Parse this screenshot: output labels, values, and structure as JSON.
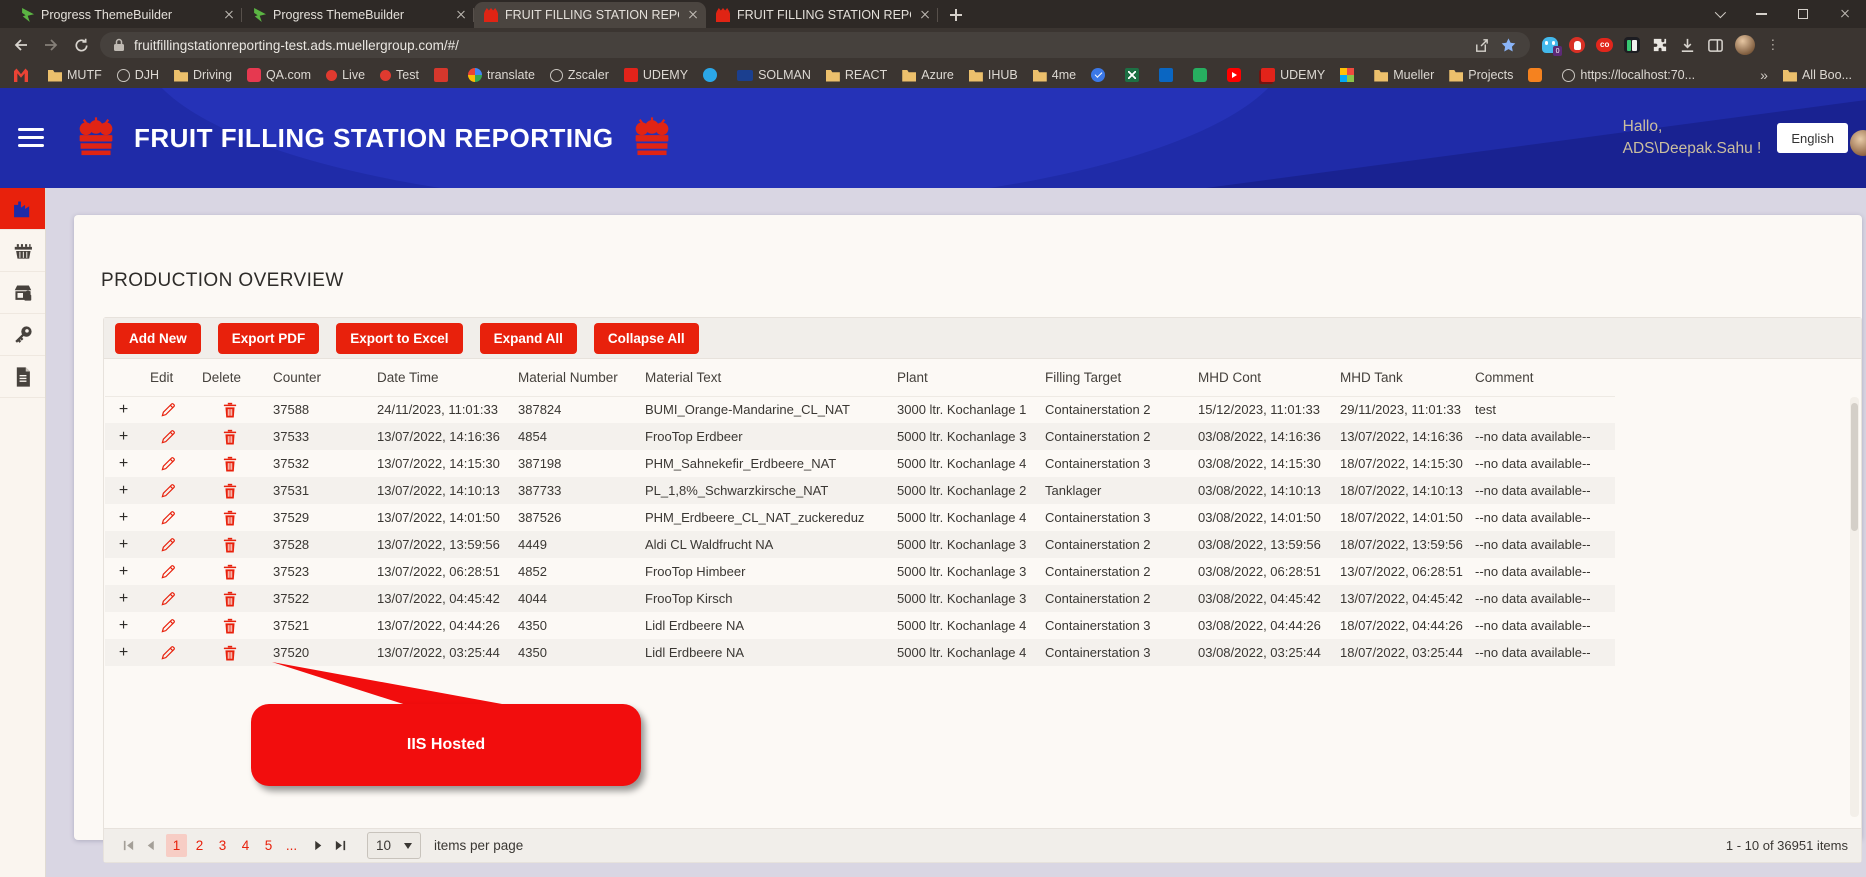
{
  "colors": {
    "accent-red": "#e8210c",
    "header-blue": "#1f2ba8",
    "callout-red": "#f20d0d"
  },
  "browser": {
    "tabs": [
      {
        "title": "Progress ThemeBuilder",
        "kind": "progress",
        "state": ""
      },
      {
        "title": "Progress ThemeBuilder",
        "kind": "progress",
        "state": ""
      },
      {
        "title": "FRUIT FILLING STATION REPORT",
        "kind": "fruit",
        "state": "active"
      },
      {
        "title": "FRUIT FILLING STATION REPORT",
        "kind": "fruit",
        "state": ""
      }
    ],
    "url": "fruitfillingstationreporting-test.ads.muellergroup.com/#/",
    "extension_badge": "0",
    "extension_co_label": "co"
  },
  "bookmarks": [
    {
      "label": "",
      "kind": "gmail"
    },
    {
      "label": "MUTF",
      "kind": "folder"
    },
    {
      "label": "DJH",
      "kind": "globe"
    },
    {
      "label": "Driving",
      "kind": "folder"
    },
    {
      "label": "QA.com",
      "kind": "qa"
    },
    {
      "label": "Live",
      "kind": "reddot"
    },
    {
      "label": "Test",
      "kind": "reddot"
    },
    {
      "label": "",
      "kind": "redgrid"
    },
    {
      "label": "translate",
      "kind": "gicon"
    },
    {
      "label": "Zscaler",
      "kind": "globe"
    },
    {
      "label": "UDEMY",
      "kind": "redsquare"
    },
    {
      "label": "",
      "kind": "swirl"
    },
    {
      "label": "SOLMAN",
      "kind": "sap"
    },
    {
      "label": "REACT",
      "kind": "folder"
    },
    {
      "label": "Azure",
      "kind": "folder"
    },
    {
      "label": "IHUB",
      "kind": "folder"
    },
    {
      "label": "4me",
      "kind": "folder"
    },
    {
      "label": "",
      "kind": "check"
    },
    {
      "label": "",
      "kind": "excel"
    },
    {
      "label": "",
      "kind": "linkedin"
    },
    {
      "label": "",
      "kind": "greenbadge"
    },
    {
      "label": "",
      "kind": "youtube"
    },
    {
      "label": "UDEMY",
      "kind": "udemy"
    },
    {
      "label": "",
      "kind": "colorgrid"
    },
    {
      "label": "Mueller",
      "kind": "folder"
    },
    {
      "label": "Projects",
      "kind": "folder"
    },
    {
      "label": "",
      "kind": "orange"
    },
    {
      "label": "https://localhost:70...",
      "kind": "globe"
    },
    {
      "label": "»",
      "kind": "overflow"
    },
    {
      "label": "All Boo...",
      "kind": "folder"
    }
  ],
  "app_header": {
    "title": "FRUIT FILLING STATION REPORTING",
    "greeting_line1": "Hallo,",
    "greeting_line2": "ADS\\Deepak.Sahu !",
    "language": "English"
  },
  "sidebar": {
    "items": [
      "factory",
      "basket",
      "store-lock",
      "key",
      "document"
    ]
  },
  "main": {
    "page_title": "PRODUCTION OVERVIEW",
    "toolbar": [
      {
        "label": "Add New"
      },
      {
        "label": "Export PDF"
      },
      {
        "label": "Export to Excel"
      },
      {
        "label": "Expand All"
      },
      {
        "label": "Collapse All"
      }
    ],
    "table": {
      "expand_glyph": "+",
      "columns": [
        "Edit",
        "Delete",
        "Counter",
        "Date Time",
        "Material Number",
        "Material Text",
        "Plant",
        "Filling Target",
        "MHD Cont",
        "MHD Tank",
        "Comment"
      ],
      "rows": [
        {
          "counter": "37588",
          "date_time": "24/11/2023, 11:01:33",
          "material_number": "387824",
          "material_text": "BUMI_Orange-Mandarine_CL_NAT",
          "plant": "3000 ltr. Kochanlage 1",
          "filling_target": "Containerstation 2",
          "mhd_cont": "15/12/2023, 11:01:33",
          "mhd_tank": "29/11/2023, 11:01:33",
          "comment": "test"
        },
        {
          "counter": "37533",
          "date_time": "13/07/2022, 14:16:36",
          "material_number": "4854",
          "material_text": "FrooTop Erdbeer",
          "plant": "5000 ltr. Kochanlage 3",
          "filling_target": "Containerstation 2",
          "mhd_cont": "03/08/2022, 14:16:36",
          "mhd_tank": "13/07/2022, 14:16:36",
          "comment": "--no data available--"
        },
        {
          "counter": "37532",
          "date_time": "13/07/2022, 14:15:30",
          "material_number": "387198",
          "material_text": "PHM_Sahnekefir_Erdbeere_NAT",
          "plant": "5000 ltr. Kochanlage 4",
          "filling_target": "Containerstation 3",
          "mhd_cont": "03/08/2022, 14:15:30",
          "mhd_tank": "18/07/2022, 14:15:30",
          "comment": "--no data available--"
        },
        {
          "counter": "37531",
          "date_time": "13/07/2022, 14:10:13",
          "material_number": "387733",
          "material_text": "PL_1,8%_Schwarzkirsche_NAT",
          "plant": "5000 ltr. Kochanlage 2",
          "filling_target": "Tanklager",
          "mhd_cont": "03/08/2022, 14:10:13",
          "mhd_tank": "18/07/2022, 14:10:13",
          "comment": "--no data available--"
        },
        {
          "counter": "37529",
          "date_time": "13/07/2022, 14:01:50",
          "material_number": "387526",
          "material_text": "PHM_Erdbeere_CL_NAT_zuckereduz",
          "plant": "5000 ltr. Kochanlage 4",
          "filling_target": "Containerstation 3",
          "mhd_cont": "03/08/2022, 14:01:50",
          "mhd_tank": "18/07/2022, 14:01:50",
          "comment": "--no data available--"
        },
        {
          "counter": "37528",
          "date_time": "13/07/2022, 13:59:56",
          "material_number": "4449",
          "material_text": "Aldi CL Waldfrucht NA",
          "plant": "5000 ltr. Kochanlage 3",
          "filling_target": "Containerstation 2",
          "mhd_cont": "03/08/2022, 13:59:56",
          "mhd_tank": "18/07/2022, 13:59:56",
          "comment": "--no data available--"
        },
        {
          "counter": "37523",
          "date_time": "13/07/2022, 06:28:51",
          "material_number": "4852",
          "material_text": "FrooTop Himbeer",
          "plant": "5000 ltr. Kochanlage 3",
          "filling_target": "Containerstation 2",
          "mhd_cont": "03/08/2022, 06:28:51",
          "mhd_tank": "13/07/2022, 06:28:51",
          "comment": "--no data available--"
        },
        {
          "counter": "37522",
          "date_time": "13/07/2022, 04:45:42",
          "material_number": "4044",
          "material_text": "FrooTop Kirsch",
          "plant": "5000 ltr. Kochanlage 3",
          "filling_target": "Containerstation 2",
          "mhd_cont": "03/08/2022, 04:45:42",
          "mhd_tank": "13/07/2022, 04:45:42",
          "comment": "--no data available--"
        },
        {
          "counter": "37521",
          "date_time": "13/07/2022, 04:44:26",
          "material_number": "4350",
          "material_text": "Lidl Erdbeere NA",
          "plant": "5000 ltr. Kochanlage 4",
          "filling_target": "Containerstation 3",
          "mhd_cont": "03/08/2022, 04:44:26",
          "mhd_tank": "18/07/2022, 04:44:26",
          "comment": "--no data available--"
        },
        {
          "counter": "37520",
          "date_time": "13/07/2022, 03:25:44",
          "material_number": "4350",
          "material_text": "Lidl Erdbeere NA",
          "plant": "5000 ltr. Kochanlage 4",
          "filling_target": "Containerstation 3",
          "mhd_cont": "03/08/2022, 03:25:44",
          "mhd_tank": "18/07/2022, 03:25:44",
          "comment": "--no data available--"
        }
      ]
    },
    "callout": {
      "label": "IIS Hosted"
    },
    "pager": {
      "pages": [
        {
          "label": "1",
          "state": "active"
        },
        {
          "label": "2",
          "state": ""
        },
        {
          "label": "3",
          "state": ""
        },
        {
          "label": "4",
          "state": ""
        },
        {
          "label": "5",
          "state": ""
        },
        {
          "label": "...",
          "state": ""
        }
      ],
      "page_size": "10",
      "items_per_page_label": "items per page",
      "info": "1 - 10 of 36951 items"
    }
  }
}
